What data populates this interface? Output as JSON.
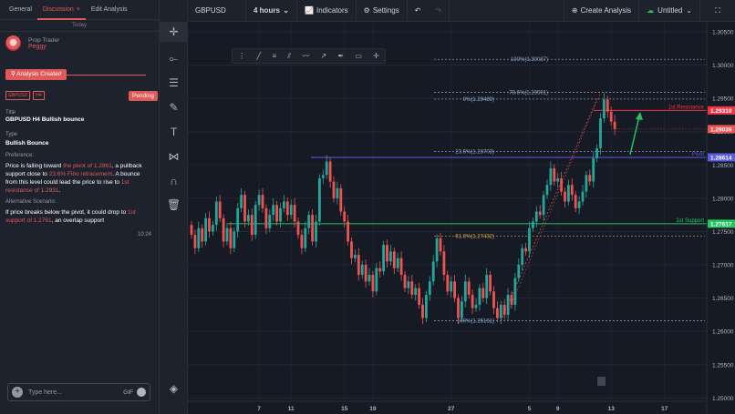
{
  "tabs": [
    {
      "label": "General"
    },
    {
      "label": "Discussion",
      "close": "×"
    },
    {
      "label": "Edit Analysis"
    }
  ],
  "today": "Today",
  "author": {
    "role": "Prop Trader",
    "name": "Peggy"
  },
  "created_label": "Analysis Created",
  "tags": [
    "GBPUSD",
    "H4"
  ],
  "status": "Pending",
  "idea_title": "GBPUSD H4 Bullish bounce",
  "title_label": "Title",
  "type_label": "Type",
  "type_value": "Bullish Bounce",
  "preference_label": "Preference:",
  "preference": {
    "p1": "Price is falling toward ",
    "h1": "the pivot of 1.2861",
    "p2": ", a pullback support close to ",
    "h2": "23.6% Fibo retracement",
    "p3": ". A bounce from this level could lead the price to rise to ",
    "h3": "1st resistance of 1.2931",
    "p4": "."
  },
  "alt_label": "Alternative Scenario:",
  "alternative": {
    "p1": "If price breaks below the pivot, it could drop to ",
    "h1": "1st support of 1.2761",
    "p2": ", an overlap support"
  },
  "message_time": "10:24",
  "chat": {
    "placeholder": "Type here...",
    "gif": "GIF"
  },
  "topbar": {
    "symbol": "GBPUSD",
    "interval": "4 hours",
    "indicators": "Indicators",
    "settings": "Settings",
    "create": "Create Analysis",
    "layout": "Untitled"
  },
  "icons": {
    "tools": [
      "crosshair-icon",
      "trendline-icon",
      "fib-icon",
      "brush-icon",
      "text-icon",
      "pattern-icon",
      "magnet-icon",
      "trash-icon",
      "layers-icon"
    ]
  },
  "chart_data": {
    "type": "candlestick",
    "symbol": "GBPUSD",
    "ylim": [
      1.2495,
      1.3065
    ],
    "y_ticks": [
      1.305,
      1.3,
      1.295,
      1.29,
      1.285,
      1.28,
      1.275,
      1.27,
      1.265,
      1.26,
      1.255,
      1.25
    ],
    "y_tick_labels": [
      "1.30500",
      "1.30000",
      "1.29500",
      "1.29000",
      "1.28500",
      "1.28000",
      "1.27500",
      "1.27000",
      "1.26500",
      "1.26000",
      "1.25500",
      "1.25000"
    ],
    "x_tick_labels": [
      "7",
      "11",
      "15",
      "19",
      "27",
      "5",
      "9",
      "13",
      "17"
    ],
    "fib_levels": [
      {
        "label": "100%(1.30087)",
        "value": 1.30087
      },
      {
        "label": "78.6%(1.29591)",
        "value": 1.29591
      },
      {
        "label": "0%(1.29489)",
        "value": 1.29489
      },
      {
        "label": "23.6%(1.28703)",
        "value": 1.28703
      },
      {
        "label": "61.8%(1.27432)",
        "value": 1.27432
      },
      {
        "label": "100%(1.26161)",
        "value": 1.26161
      }
    ],
    "lines": [
      {
        "name": "1st Resistance",
        "value": 1.29319,
        "color": "#f23645",
        "tag": "1.29319"
      },
      {
        "name": "Pivot",
        "value": 1.28614,
        "color": "#5b5be0",
        "tag": "1.28614"
      },
      {
        "name": "1st Support",
        "value": 1.27617,
        "color": "#22c55e",
        "tag": "1.27617"
      }
    ],
    "last_price": {
      "value": 1.29039,
      "tag": "1.29039"
    },
    "closes": [
      1.2745,
      1.2725,
      1.2755,
      1.2735,
      1.277,
      1.275,
      1.276,
      1.2795,
      1.277,
      1.2735,
      1.2755,
      1.2725,
      1.275,
      1.2785,
      1.2805,
      1.2765,
      1.2775,
      1.2745,
      1.279,
      1.2805,
      1.2785,
      1.2755,
      1.2775,
      1.279,
      1.2765,
      1.2785,
      1.2795,
      1.2775,
      1.279,
      1.2765,
      1.2745,
      1.2725,
      1.2755,
      1.2775,
      1.2735,
      1.2765,
      1.283,
      1.2835,
      1.2855,
      1.2825,
      1.28,
      1.2815,
      1.278,
      1.2765,
      1.2735,
      1.271,
      1.2715,
      1.2685,
      1.27,
      1.2675,
      1.2685,
      1.266,
      1.2695,
      1.269,
      1.273,
      1.2705,
      1.272,
      1.2695,
      1.271,
      1.2685,
      1.2665,
      1.2675,
      1.2655,
      1.2665,
      1.264,
      1.262,
      1.2655,
      1.2675,
      1.2705,
      1.274,
      1.272,
      1.2685,
      1.266,
      1.2675,
      1.265,
      1.262,
      1.2645,
      1.2675,
      1.2655,
      1.2635,
      1.264,
      1.2665,
      1.265,
      1.2685,
      1.266,
      1.2635,
      1.262,
      1.264,
      1.2625,
      1.2655,
      1.264,
      1.268,
      1.27,
      1.2725,
      1.272,
      1.2755,
      1.2765,
      1.278,
      1.2775,
      1.2805,
      1.282,
      1.2845,
      1.2825,
      1.283,
      1.281,
      1.2795,
      1.282,
      1.2805,
      1.2785,
      1.2795,
      1.281,
      1.2835,
      1.2825,
      1.286,
      1.2875,
      1.292,
      1.2948,
      1.293,
      1.2915,
      1.2904
    ]
  }
}
